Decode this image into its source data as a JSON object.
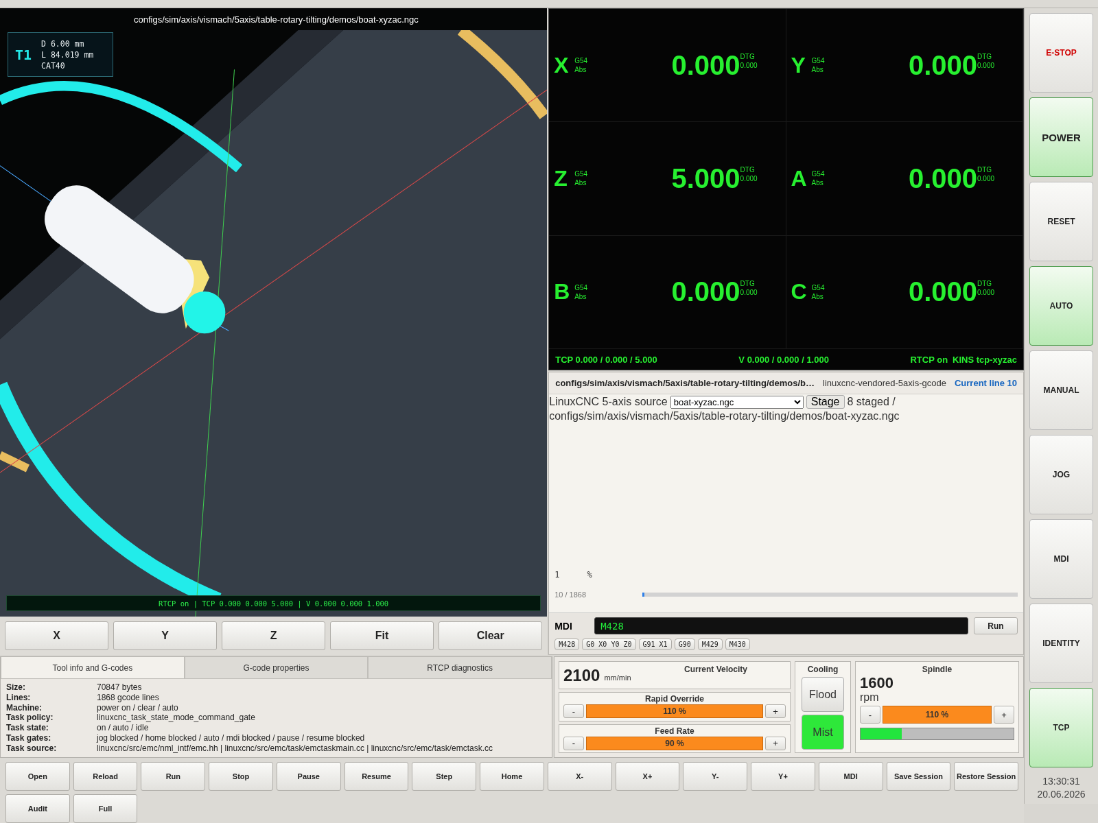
{
  "viewer": {
    "title": "configs/sim/axis/vismach/5axis/table-rotary-tilting/demos/boat-xyzac.ngc",
    "tool": {
      "number": "T1",
      "lines": [
        "D 6.00 mm",
        "L 84.019 mm",
        "CAT40"
      ]
    },
    "status": "RTCP on | TCP 0.000 0.000 5.000 | V 0.000 0.000 1.000",
    "buttons": [
      "X",
      "Y",
      "Z",
      "Fit",
      "Clear"
    ]
  },
  "dro": {
    "axes": [
      {
        "letter": "X",
        "offset": "G54",
        "mode": "Abs",
        "value": "0.000",
        "dtg_label": "DTG",
        "dtg": "0.000"
      },
      {
        "letter": "Y",
        "offset": "G54",
        "mode": "Abs",
        "value": "0.000",
        "dtg_label": "DTG",
        "dtg": "0.000"
      },
      {
        "letter": "Z",
        "offset": "G54",
        "mode": "Abs",
        "value": "5.000",
        "dtg_label": "DTG",
        "dtg": "0.000"
      },
      {
        "letter": "A",
        "offset": "G54",
        "mode": "Abs",
        "value": "0.000",
        "dtg_label": "DTG",
        "dtg": "0.000"
      },
      {
        "letter": "B",
        "offset": "G54",
        "mode": "Abs",
        "value": "0.000",
        "dtg_label": "DTG",
        "dtg": "0.000"
      },
      {
        "letter": "C",
        "offset": "G54",
        "mode": "Abs",
        "value": "0.000",
        "dtg_label": "DTG",
        "dtg": "0.000"
      }
    ],
    "footer": {
      "tcp": "TCP 0.000 / 0.000 / 5.000",
      "velocity": "V 0.000 / 0.000 / 1.000",
      "rtcp": "RTCP on",
      "kins": "KINS tcp-xyzac"
    }
  },
  "program": {
    "path": "configs/sim/axis/vismach/5axis/table-rotary-tilting/demos/b…",
    "source_tag": "linuxcnc-vendored-5axis-gcode",
    "current_line": "Current line 10",
    "source_label": "LinuxCNC 5-axis source",
    "source_file": "boat-xyzac.ngc",
    "stage_button": "Stage",
    "staged": "8 staged /",
    "staged_path": "configs/sim/axis/vismach/5axis/table-rotary-tilting/demos/boat-xyzac.ngc",
    "code_lines": [
      {
        "number": "1",
        "text": "%"
      }
    ],
    "progress_text": "10 / 1868",
    "progress": {
      "level": 0.005
    }
  },
  "mdi": {
    "label": "MDI",
    "value": "M428",
    "run": "Run",
    "chips": [
      "M428",
      "G0 X0 Y0 Z0",
      "G91 X1",
      "G90",
      "M429",
      "M430"
    ]
  },
  "info": {
    "tabs": [
      {
        "label": "Tool info and G-codes",
        "selected": true
      },
      {
        "label": "G-code properties",
        "selected": false
      },
      {
        "label": "RTCP diagnostics",
        "selected": false
      }
    ],
    "rows": [
      {
        "key": "Size:",
        "value": "70847 bytes"
      },
      {
        "key": "Lines:",
        "value": "1868 gcode lines"
      },
      {
        "key": "Machine:",
        "value": "power on / clear / auto"
      },
      {
        "key": "Task policy:",
        "value": "linuxcnc_task_state_mode_command_gate"
      },
      {
        "key": "Task state:",
        "value": "on / auto / idle"
      },
      {
        "key": "Task gates:",
        "value": "jog blocked / home blocked / auto / mdi blocked / pause / resume blocked"
      },
      {
        "key": "Task source:",
        "value": "linuxcnc/src/emc/nml_intf/emc.hh | linuxcnc/src/emc/task/emctaskmain.cc | linuxcnc/src/emc/task/emctask.cc"
      }
    ]
  },
  "velocity": {
    "title": "Current Velocity",
    "value": "2100",
    "unit": "mm/min"
  },
  "overrides": [
    {
      "title": "Rapid Override",
      "minus": "-",
      "reading": "110 %",
      "plus": "+"
    },
    {
      "title": "Feed Rate",
      "minus": "-",
      "reading": "90 %",
      "plus": "+"
    }
  ],
  "cooling": {
    "title": "Cooling",
    "buttons": [
      {
        "label": "Flood",
        "on": false
      },
      {
        "label": "Mist",
        "on": true
      }
    ]
  },
  "spindle": {
    "title": "Spindle",
    "speed": "1600",
    "unit": "rpm",
    "minus": "-",
    "reading": "110 %",
    "plus": "+",
    "load": {
      "level": 0.27
    }
  },
  "modes": [
    {
      "label": "E-STOP",
      "kind": "estop",
      "on": false
    },
    {
      "label": "POWER",
      "kind": "big",
      "on": true
    },
    {
      "label": "RESET",
      "kind": "normal",
      "on": false
    },
    {
      "label": "AUTO",
      "kind": "normal",
      "on": true
    },
    {
      "label": "MANUAL",
      "kind": "normal",
      "on": false
    },
    {
      "label": "JOG",
      "kind": "normal",
      "on": false
    },
    {
      "label": "MDI",
      "kind": "normal",
      "on": false
    },
    {
      "label": "IDENTITY",
      "kind": "normal",
      "on": false
    },
    {
      "label": "TCP",
      "kind": "normal",
      "on": true
    }
  ],
  "clock": {
    "time": "13:30:31",
    "date": "20.06.2026"
  },
  "toolbar": [
    "Open",
    "Reload",
    "Run",
    "Stop",
    "Pause",
    "Resume",
    "Step",
    "Home",
    "X-",
    "X+",
    "Y-",
    "Y+",
    "MDI",
    "Save Session",
    "Restore Session",
    "Audit",
    "Full"
  ]
}
